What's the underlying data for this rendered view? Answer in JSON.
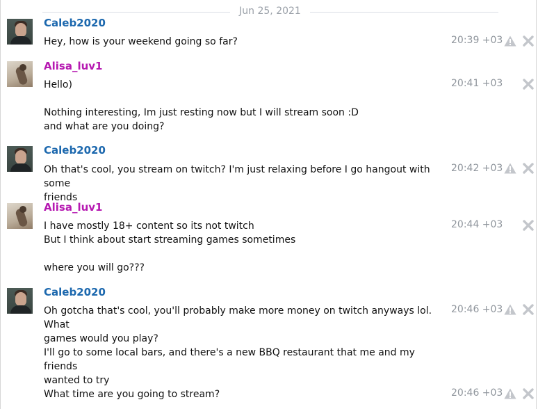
{
  "date_separator": "Jun 25, 2021",
  "colors": {
    "caleb": "#1c68ae",
    "alisa": "#b619b1",
    "timestamp": "#8f959c",
    "icon": "#c3c6cb"
  },
  "icons": {
    "warning": "warning-icon",
    "delete": "close-icon"
  },
  "messages": [
    {
      "user": "Caleb2020",
      "text": "Hey, how is your weekend going so far?",
      "time": "20:39 +03"
    },
    {
      "user": "Alisa_luv1",
      "text": "Hello)",
      "time": "20:41 +03"
    },
    {
      "text": "Nothing interesting, Im just resting now but I will stream soon :D",
      "text2": "and what are you doing?"
    },
    {
      "user": "Caleb2020",
      "text": "Oh that's cool, you stream on twitch? I'm just relaxing before I go hangout with some",
      "text2": "friends",
      "time": "20:42 +03"
    },
    {
      "user": "Alisa_luv1",
      "text": "I have mostly 18+ content so its not twitch",
      "text2": "But I think about start streaming games sometimes",
      "time": "20:44 +03"
    },
    {
      "text": "where you will go???"
    },
    {
      "user": "Caleb2020",
      "text": "Oh gotcha that's cool, you'll probably make more money on twitch anyways lol. What",
      "text2": "games would you play?",
      "time": "20:46 +03"
    },
    {
      "text": "I'll go to some local bars, and there's a new BBQ restaurant that me and my friends",
      "text2": "wanted to try"
    },
    {
      "text": "What time are you going to stream?",
      "time": "20:46 +03"
    }
  ]
}
